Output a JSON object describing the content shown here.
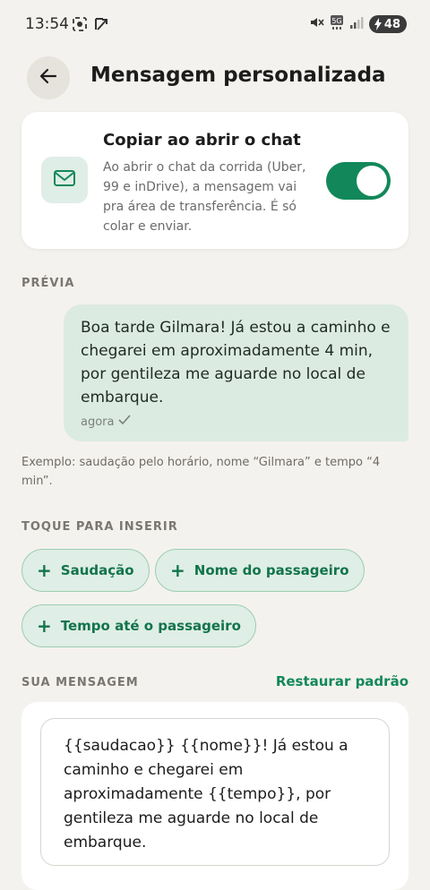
{
  "status_bar": {
    "time": "13:54",
    "battery": "48",
    "icons": [
      "screenshot-icon",
      "share-icon",
      "mute-icon",
      "5g-icon",
      "signal-icon",
      "battery-icon"
    ]
  },
  "header": {
    "back_icon": "arrow-left-icon",
    "title": "Mensagem personalizada"
  },
  "copy_card": {
    "icon": "mail-icon",
    "title": "Copiar ao abrir o chat",
    "description": "Ao abrir o chat da corrida (Uber, 99 e inDrive), a mensagem vai pra área de transferência. É só colar e enviar.",
    "toggle_on": true
  },
  "preview": {
    "label": "PRÉVIA",
    "message": "Boa tarde Gilmara! Já estou a caminho e chegarei em aproximadamente 4 min, por gentileza me aguarde no local de embarque.",
    "time": "agora",
    "example": "Exemplo: saudação pelo horário, nome “Gilmara” e tempo “4 min”."
  },
  "insert": {
    "label": "TOQUE PARA INSERIR",
    "chips": [
      "Saudação",
      "Nome do passageiro",
      "Tempo até o passageiro"
    ]
  },
  "message": {
    "label": "SUA MENSAGEM",
    "restore_label": "Restaurar padrão",
    "text": "{{saudacao}} {{nome}}! Já estou a caminho e chegarei em aproximadamente {{tempo}}, por gentileza me aguarde no local de embarque."
  },
  "colors": {
    "accent": "#12885a",
    "chip_bg": "#dfeee6",
    "bubble_bg": "#dcebe1",
    "background": "#f4f2ee"
  }
}
